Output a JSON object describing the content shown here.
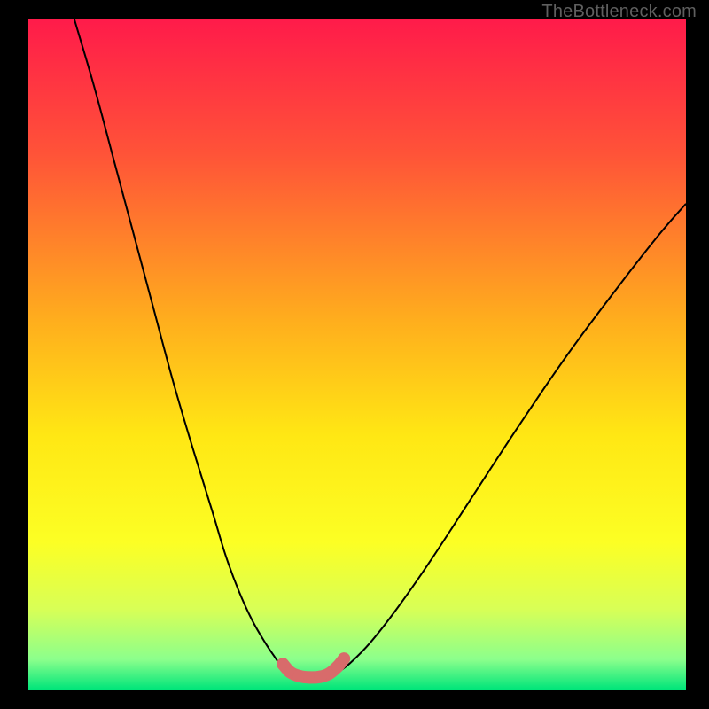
{
  "watermark": "TheBottleneck.com",
  "chart_data": {
    "type": "line",
    "title": "",
    "xlabel": "",
    "ylabel": "",
    "xlim": [
      0,
      100
    ],
    "ylim": [
      0,
      100
    ],
    "grid": false,
    "legend": false,
    "background_gradient": {
      "stops": [
        {
          "pos": 0.0,
          "color": "#ff1b4a"
        },
        {
          "pos": 0.2,
          "color": "#ff5338"
        },
        {
          "pos": 0.45,
          "color": "#ffae1d"
        },
        {
          "pos": 0.62,
          "color": "#ffe714"
        },
        {
          "pos": 0.78,
          "color": "#fcff24"
        },
        {
          "pos": 0.88,
          "color": "#d8ff56"
        },
        {
          "pos": 0.955,
          "color": "#8cff8c"
        },
        {
          "pos": 1.0,
          "color": "#00e57a"
        }
      ]
    },
    "series": [
      {
        "name": "left-curve",
        "stroke": "#000000",
        "stroke_width": 2,
        "x": [
          7.0,
          10.0,
          13.0,
          16.0,
          19.0,
          22.0,
          25.0,
          28.0,
          30.0,
          32.0,
          34.0,
          36.0,
          37.5,
          38.5,
          39.3
        ],
        "y": [
          100.0,
          90.0,
          79.0,
          68.0,
          57.0,
          46.0,
          36.0,
          26.5,
          20.0,
          14.7,
          10.4,
          7.0,
          4.8,
          3.4,
          2.5
        ]
      },
      {
        "name": "right-curve",
        "stroke": "#000000",
        "stroke_width": 2,
        "x": [
          47.0,
          49.0,
          52.0,
          56.0,
          61.0,
          67.0,
          74.0,
          82.0,
          90.0,
          96.0,
          100.0
        ],
        "y": [
          2.5,
          4.0,
          7.0,
          12.0,
          19.0,
          28.0,
          38.5,
          50.0,
          60.5,
          68.0,
          72.5
        ]
      },
      {
        "name": "highlight-dots",
        "stroke": "#d86b6b",
        "stroke_width": 14,
        "linecap": "round",
        "x": [
          38.7,
          39.8,
          41.2,
          42.8,
          44.4,
          45.8,
          47.0,
          48.0
        ],
        "y": [
          3.8,
          2.6,
          2.0,
          1.8,
          1.9,
          2.4,
          3.4,
          4.6
        ]
      }
    ]
  }
}
